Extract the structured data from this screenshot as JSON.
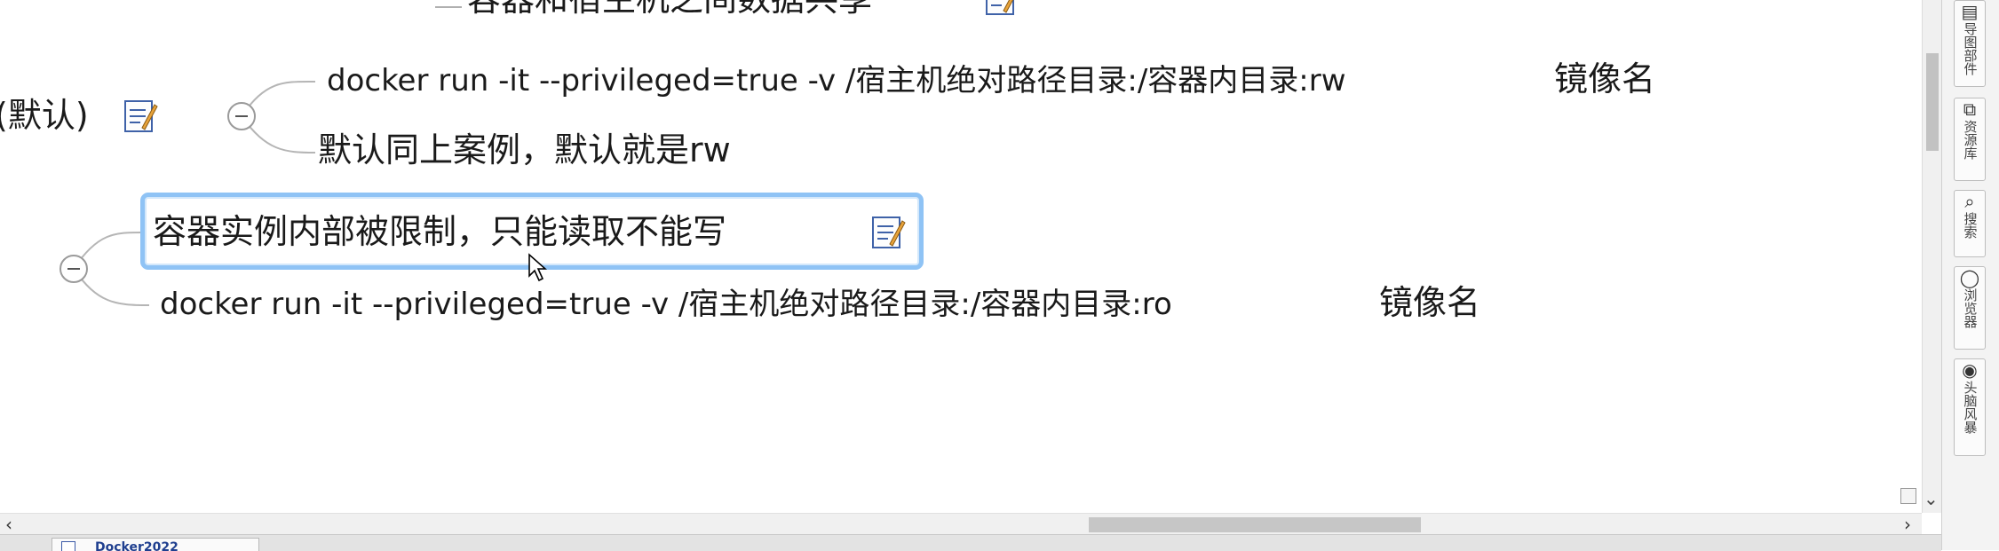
{
  "mindmap": {
    "top_partial": "容器和宿主机之间数据共享",
    "left_partial": "(默认)",
    "rw_command": "docker run -it --privileged=true -v /宿主机绝对路径目录:/容器内目录:rw",
    "rw_image": "镜像名",
    "rw_default": "默认同上案例，默认就是rw",
    "ro_title": "容器实例内部被限制，只能读取不能写",
    "ro_command": "docker run -it --privileged=true -v /宿主机绝对路径目录:/容器内目录:ro",
    "ro_image": "镜像名"
  },
  "scrollbar": {
    "left_arrow": "‹",
    "right_arrow": "›",
    "down_arrow": "⌄"
  },
  "tabs": [
    {
      "label": "Docker2022"
    }
  ],
  "side_panel": [
    {
      "icon": "map-parts-icon",
      "glyph": "▤",
      "label": "导图部件"
    },
    {
      "icon": "library-icon",
      "glyph": "⧉",
      "label": "资源库"
    },
    {
      "icon": "search-icon",
      "glyph": "⌕",
      "label": "搜索"
    },
    {
      "icon": "browser-icon",
      "glyph": "◯",
      "label": "浏览器"
    },
    {
      "icon": "brainstorm-icon",
      "glyph": "◉",
      "label": "头脑风暴"
    }
  ]
}
